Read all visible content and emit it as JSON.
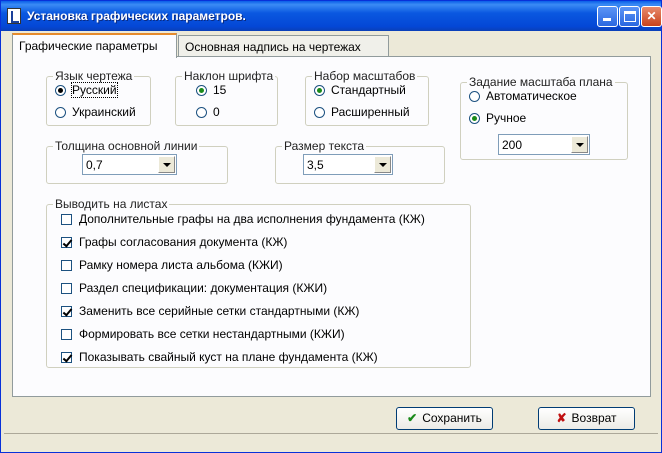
{
  "window": {
    "title": "Установка графических параметров."
  },
  "tabs": [
    {
      "label": "Графические параметры",
      "active": true
    },
    {
      "label": "Основная надпись на чертежах",
      "active": false
    }
  ],
  "language": {
    "legend": "Язык чертежа",
    "options": [
      {
        "label": "Русский",
        "selected": true
      },
      {
        "label": "Украинский",
        "selected": false
      }
    ]
  },
  "slant": {
    "legend": "Наклон шрифта",
    "options": [
      {
        "label": "15",
        "selected": true
      },
      {
        "label": "0",
        "selected": false
      }
    ]
  },
  "scales": {
    "legend": "Набор масштабов",
    "options": [
      {
        "label": "Стандартный",
        "selected": true
      },
      {
        "label": "Расширенный",
        "selected": false
      }
    ]
  },
  "plan_scale": {
    "legend": "Задание масштаба плана",
    "options": [
      {
        "label": "Автоматическое",
        "selected": false
      },
      {
        "label": "Ручное",
        "selected": true
      }
    ],
    "value": "200"
  },
  "line_width": {
    "legend": "Толщина основной линии",
    "value": "0,7"
  },
  "text_size": {
    "legend": "Размер текста",
    "value": "3,5"
  },
  "output": {
    "legend": "Выводить на листах",
    "items": [
      {
        "label": "Дополнительные графы на два исполнения фундамента (КЖ)",
        "checked": false
      },
      {
        "label": "Графы согласования документа (КЖ)",
        "checked": true
      },
      {
        "label": "Рамку номера листа альбома (КЖИ)",
        "checked": false
      },
      {
        "label": "Раздел спецификации: документация (КЖИ)",
        "checked": false
      },
      {
        "label": "Заменить все серийные сетки стандартными (КЖ)",
        "checked": true
      },
      {
        "label": "Формировать все сетки нестандартными (КЖИ)",
        "checked": false
      },
      {
        "label": "Показывать свайный куст на плане фундамента (КЖ)",
        "checked": true
      }
    ]
  },
  "buttons": {
    "save": "Сохранить",
    "cancel": "Возврат"
  },
  "colors": {
    "titlebar": "#0a58e0",
    "face": "#ece9d8",
    "panel": "#fcfcfe",
    "save_icon": "#1a8a1a",
    "cancel_icon": "#c01010"
  }
}
